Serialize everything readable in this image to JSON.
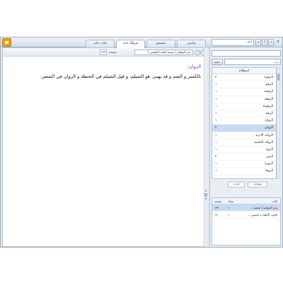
{
  "top": {
    "tabs": [
      {
        "label": "کتاب خانه"
      },
      {
        "label": "فرهنگ نامه"
      },
      {
        "label": "جستجو"
      },
      {
        "label": "نمایش"
      }
    ],
    "search_value": "ازم",
    "tool_icons": [
      "«",
      "?",
      "»",
      "×"
    ]
  },
  "content": {
    "page_number": "۱۹۹",
    "page_label": "صفحه:",
    "book_title": "بحر الجواهر ( معجم الطب الطبيعي )",
    "entry_title": "الزوان:",
    "body": "بالكسر و الضم و قد يهمز، هو الشيلم، و قيل الشيلم في الحنطة و الزوان في الشعير."
  },
  "right": {
    "filter_placeholder": "واژه",
    "filter_button": "دامنه",
    "list_header": "اصطلاح",
    "terms": [
      {
        "word": "الزهرة",
        "count": "۲"
      },
      {
        "word": "الزهم",
        "count": "۱"
      },
      {
        "word": "الزهمة",
        "count": "۱"
      },
      {
        "word": "الزهقة",
        "count": "۱"
      },
      {
        "word": "الزهومة",
        "count": "۱"
      },
      {
        "word": "الزهيد",
        "count": "۱"
      },
      {
        "word": "الزواج",
        "count": "۱"
      },
      {
        "word": "الزوان",
        "count": "۲"
      },
      {
        "word": "الزوائد الابرية",
        "count": "۱"
      },
      {
        "word": "الزوائد الحلمية",
        "count": "۱"
      },
      {
        "word": "الزوج",
        "count": "۱"
      },
      {
        "word": "الزور",
        "count": "۲"
      },
      {
        "word": "الزورة",
        "count": "۱"
      },
      {
        "word": "الزوفا",
        "count": "۱"
      }
    ],
    "selected_term_index": 7,
    "counter_a": "۲۱۳۸۸",
    "counter_b": "۱۰۴۷",
    "table_headers": {
      "book": "کتاب",
      "count": "تعداد",
      "page": "صفحه"
    },
    "books": [
      {
        "book": "بحر الجواهر ( معجم ...",
        "count": "۱",
        "page": "۱۹۹"
      },
      {
        "book": "قانون الأطباء و ناموس ...",
        "count": "۱",
        "page": "۱۷۰"
      }
    ]
  }
}
